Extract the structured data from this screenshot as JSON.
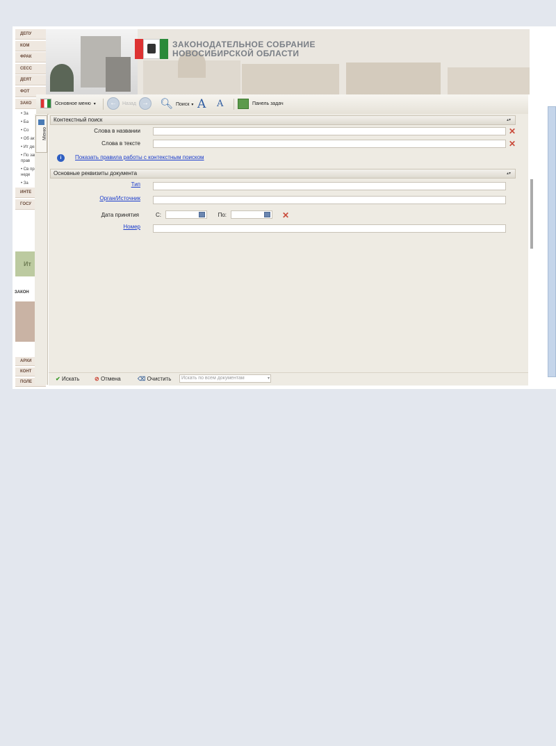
{
  "banner": {
    "title_line1": "ЗАКОНОДАТЕЛЬНОЕ СОБРАНИЕ",
    "title_line2": "НОВОСИБИРСКОЙ ОБЛАСТИ"
  },
  "bg_menu": {
    "items": [
      "ДЕПУ",
      "КОМ",
      "ФРАК",
      "СЕСС",
      "ДЕЯТ",
      "ФОТ",
      "ЗАКО"
    ],
    "subs": [
      "• За",
      "• Ба",
      "• Со",
      "• Об акто",
      "• Ит деят",
      "• По зако прав",
      "• Св прио неде",
      "• За"
    ],
    "items2": [
      "ИНТЕ",
      "ГОСУ"
    ],
    "items3": [
      "АРХИ",
      "КОНТ",
      "ПОЛЕ"
    ],
    "person_label": "ЗАКОН",
    "thumb_text": "Ит"
  },
  "toolbar": {
    "main_menu": "Основное меню",
    "back": "Назад",
    "search": "Поиск",
    "task_panel": "Панель задач"
  },
  "side_tab": {
    "label": "Меню"
  },
  "context_search": {
    "header": "Контекстный поиск",
    "title_words_label": "Слова в названии",
    "title_words_value": "",
    "text_words_label": "Слова в тексте",
    "text_words_value": "",
    "rules_link": "Показать правила работы с контекстным поиском"
  },
  "doc_requisites": {
    "header": "Основные реквизиты документа",
    "type_label": "Тип",
    "type_value": "",
    "organ_label": "Орган/Источник",
    "organ_value": "",
    "date_label": "Дата принятия",
    "from_label": "С:",
    "to_label": "По:",
    "from_value": "",
    "to_value": "",
    "number_label": "Номер",
    "number_value": ""
  },
  "bottom": {
    "search_btn": "Искать",
    "cancel_btn": "Отмена",
    "clear_btn": "Очистить",
    "scope_select": "Искать по всем документам"
  }
}
